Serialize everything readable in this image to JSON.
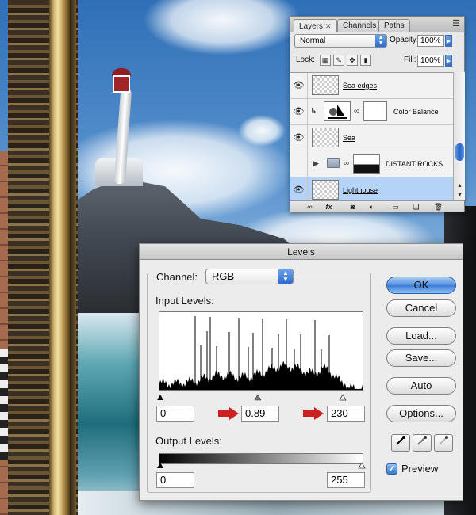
{
  "layers_panel": {
    "tabs": [
      {
        "label": "Layers",
        "active": true
      },
      {
        "label": "Channels",
        "active": false
      },
      {
        "label": "Paths",
        "active": false
      }
    ],
    "blend_mode": "Normal",
    "opacity_label": "Opacity:",
    "opacity_value": "100%",
    "lock_label": "Lock:",
    "fill_label": "Fill:",
    "fill_value": "100%",
    "layers": [
      {
        "name": "Sea edges",
        "type": "layer",
        "visible": true,
        "selected": false
      },
      {
        "name": "Color Balance",
        "type": "adjustment",
        "visible": true,
        "selected": false
      },
      {
        "name": "Sea",
        "type": "layer",
        "visible": true,
        "selected": false
      },
      {
        "name": "DISTANT ROCKS",
        "type": "group",
        "visible": false,
        "selected": false
      },
      {
        "name": "Lighthouse",
        "type": "layer",
        "visible": true,
        "selected": true
      }
    ],
    "footer_icons": [
      "link-icon",
      "fx-icon",
      "layer-mask-icon",
      "adjustment-layer-icon",
      "new-group-icon",
      "new-layer-icon",
      "trash-icon"
    ]
  },
  "levels_dialog": {
    "title": "Levels",
    "channel_label": "Channel:",
    "channel_value": "RGB",
    "input_levels_label": "Input Levels:",
    "input_black": "0",
    "input_gamma": "0.89",
    "input_white": "230",
    "output_levels_label": "Output Levels:",
    "output_black": "0",
    "output_white": "255",
    "buttons": {
      "ok": "OK",
      "cancel": "Cancel",
      "load": "Load...",
      "save": "Save...",
      "auto": "Auto",
      "options": "Options..."
    },
    "preview_label": "Preview",
    "preview_checked": true,
    "accent_color": "#3b7bd6",
    "arrow_color": "#cc1f1f"
  }
}
